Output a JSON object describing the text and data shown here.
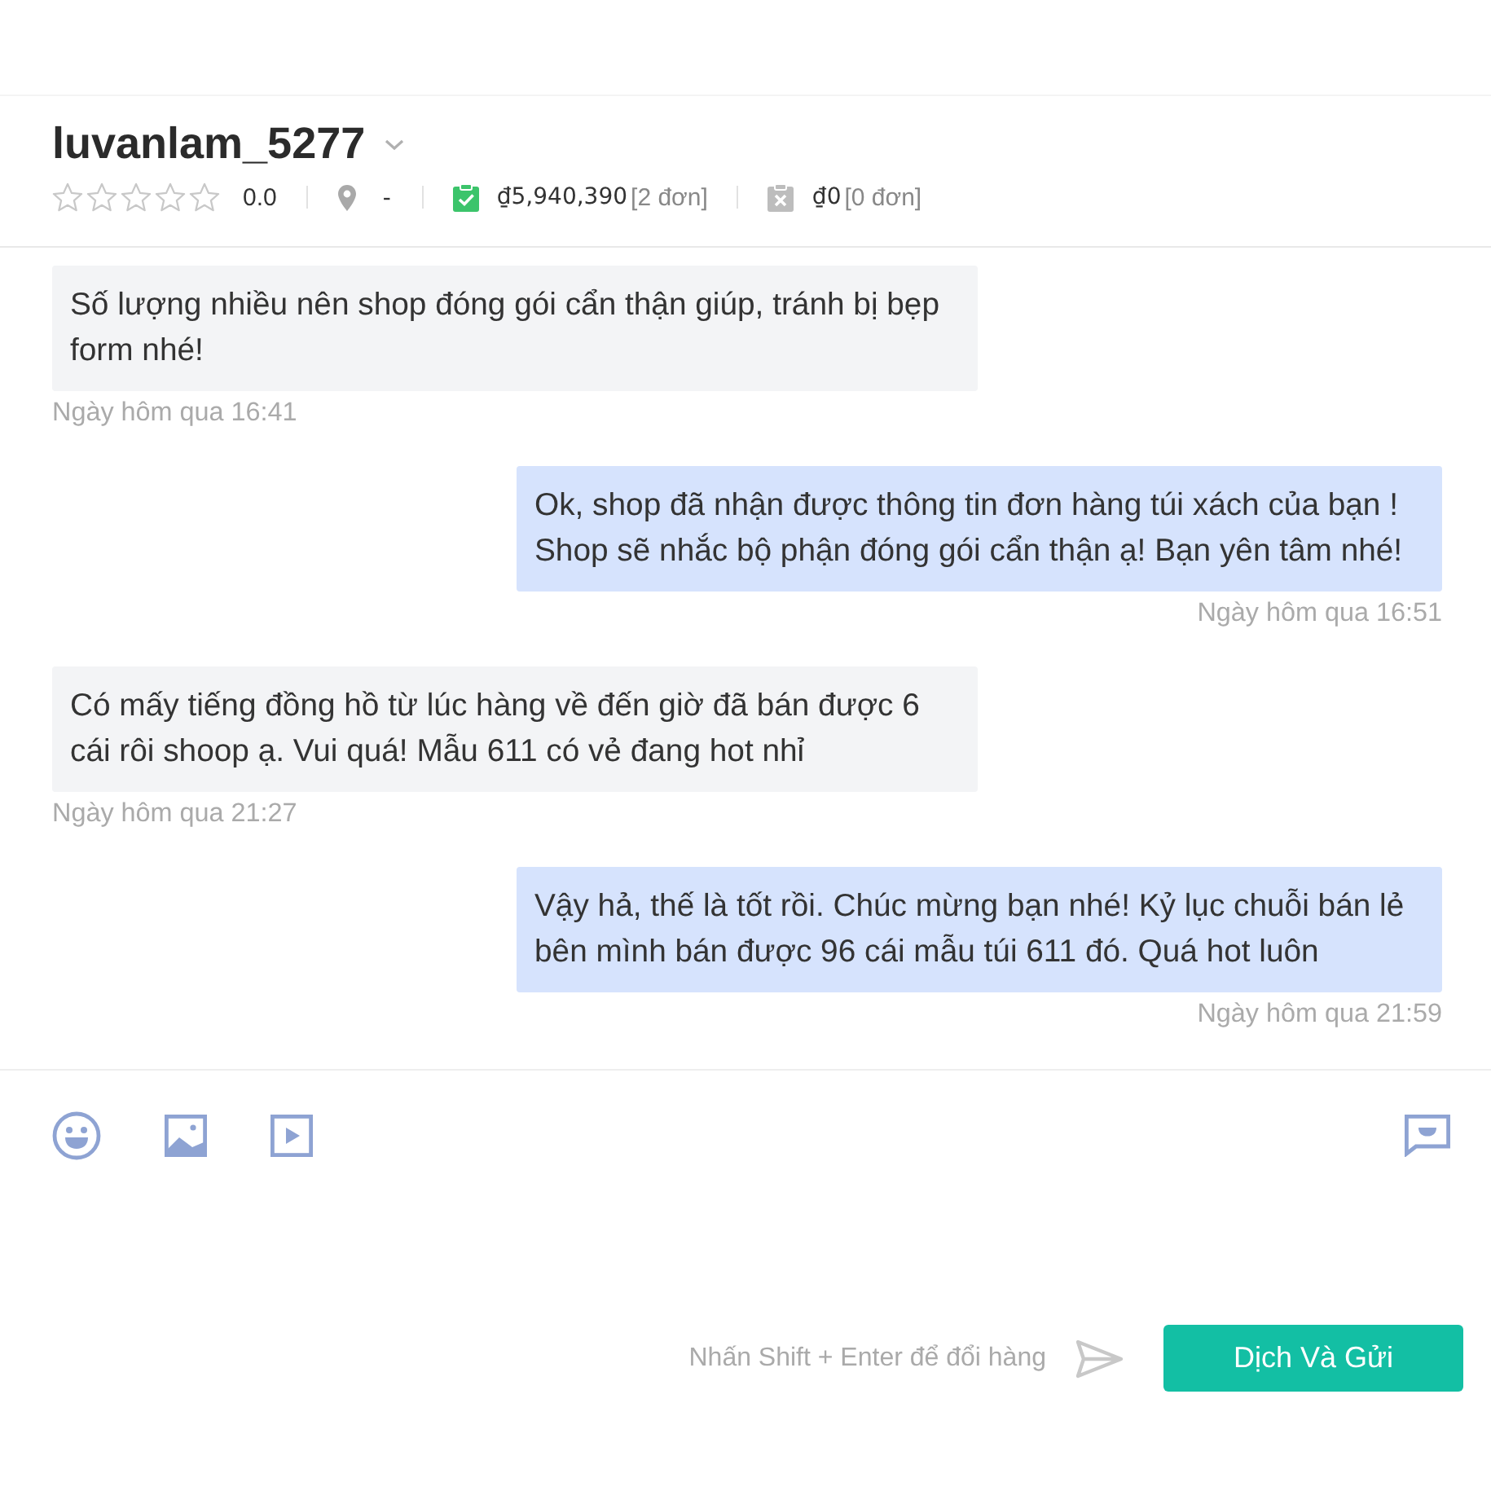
{
  "header": {
    "username": "luvanlam_5277",
    "stars": 0,
    "rating": "0.0",
    "location": "-",
    "completed": {
      "amount": "₫5,940,390",
      "orders": "[2 đơn]"
    },
    "cancelled": {
      "amount": "₫0",
      "orders": "[0 đơn]"
    }
  },
  "messages": [
    {
      "kind": "received",
      "text": "Số lượng nhiều nên shop đóng gói cẩn thận giúp, tránh bị bẹp form nhé!",
      "time": "Ngày hôm qua 16:41"
    },
    {
      "kind": "sent",
      "text": "Ok, shop đã nhận được thông tin đơn hàng túi xách của bạn ! Shop sẽ nhắc bộ phận đóng gói cẩn thận ạ! Bạn yên tâm nhé!",
      "time": "Ngày hôm qua 16:51"
    },
    {
      "kind": "received",
      "text": "Có mấy tiếng đồng hồ từ lúc hàng về đến giờ đã bán được 6 cái rôi shoop ạ. Vui quá! Mẫu 611 có vẻ đang hot nhỉ",
      "time": "Ngày hôm qua 21:27"
    },
    {
      "kind": "sent",
      "text": "Vậy hả, thế là tốt rồi. Chúc mừng bạn nhé! Kỷ lục chuỗi bán lẻ bên mình bán được 96 cái mẫu túi 611 đó. Quá hot luôn",
      "time": "Ngày hôm qua 21:59"
    }
  ],
  "composer": {
    "hint": "Nhấn Shift + Enter để đổi hàng",
    "button": "Dịch Và Gửi"
  }
}
